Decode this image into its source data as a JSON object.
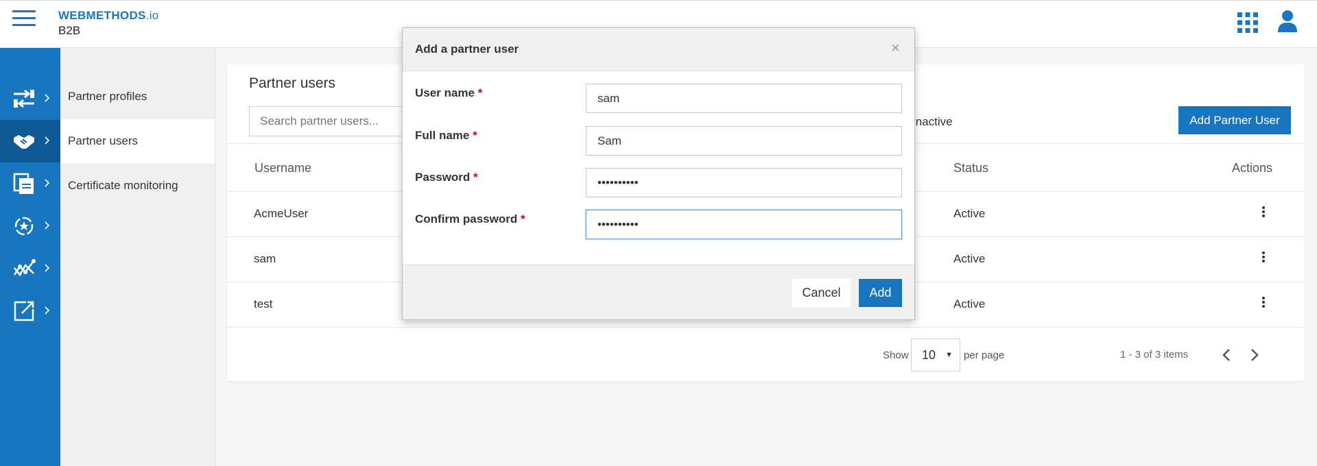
{
  "app": {
    "brand_name": "WEBMETHODS",
    "brand_suffix": ".io",
    "subtitle": "B2B"
  },
  "icons": {
    "menu": "hamburger-menu-icon",
    "apps": "app-grid-icon",
    "user": "user-profile-icon"
  },
  "rail": {
    "items": [
      {
        "icon": "transfer-arrows-icon"
      },
      {
        "icon": "handshake-icon"
      },
      {
        "icon": "documents-icon"
      },
      {
        "icon": "gear-cycle-icon"
      },
      {
        "icon": "analytics-chart-icon"
      },
      {
        "icon": "external-link-icon"
      }
    ]
  },
  "subnav": {
    "items": [
      {
        "label": "Partner profiles"
      },
      {
        "label": "Partner users"
      },
      {
        "label": "Certificate monitoring"
      }
    ]
  },
  "page": {
    "title": "Partner users",
    "search_placeholder": "Search partner users...",
    "inactive_label": "inactive",
    "add_button": "Add Partner User",
    "columns": {
      "username": "Username",
      "status": "Status",
      "actions": "Actions"
    },
    "rows": [
      {
        "username": "AcmeUser",
        "status": "Active"
      },
      {
        "username": "sam",
        "status": "Active"
      },
      {
        "username": "test",
        "status": "Active"
      }
    ],
    "pager": {
      "show": "Show",
      "page_size": "10",
      "per_page": "per page",
      "count": "1 - 3 of 3 items"
    }
  },
  "modal": {
    "title": "Add a partner user",
    "close": "×",
    "fields": {
      "username": {
        "label": "User name",
        "value": "sam"
      },
      "fullname": {
        "label": "Full name",
        "value": "Sam"
      },
      "password": {
        "label": "Password",
        "value": "••••••••••"
      },
      "confirm": {
        "label": "Confirm password",
        "value": "••••••••••"
      }
    },
    "required_mark": "*",
    "cancel": "Cancel",
    "add": "Add"
  },
  "colors": {
    "brand_blue": "#1776bf",
    "rail_active": "#0e5a96",
    "required_red": "#d0021b"
  }
}
